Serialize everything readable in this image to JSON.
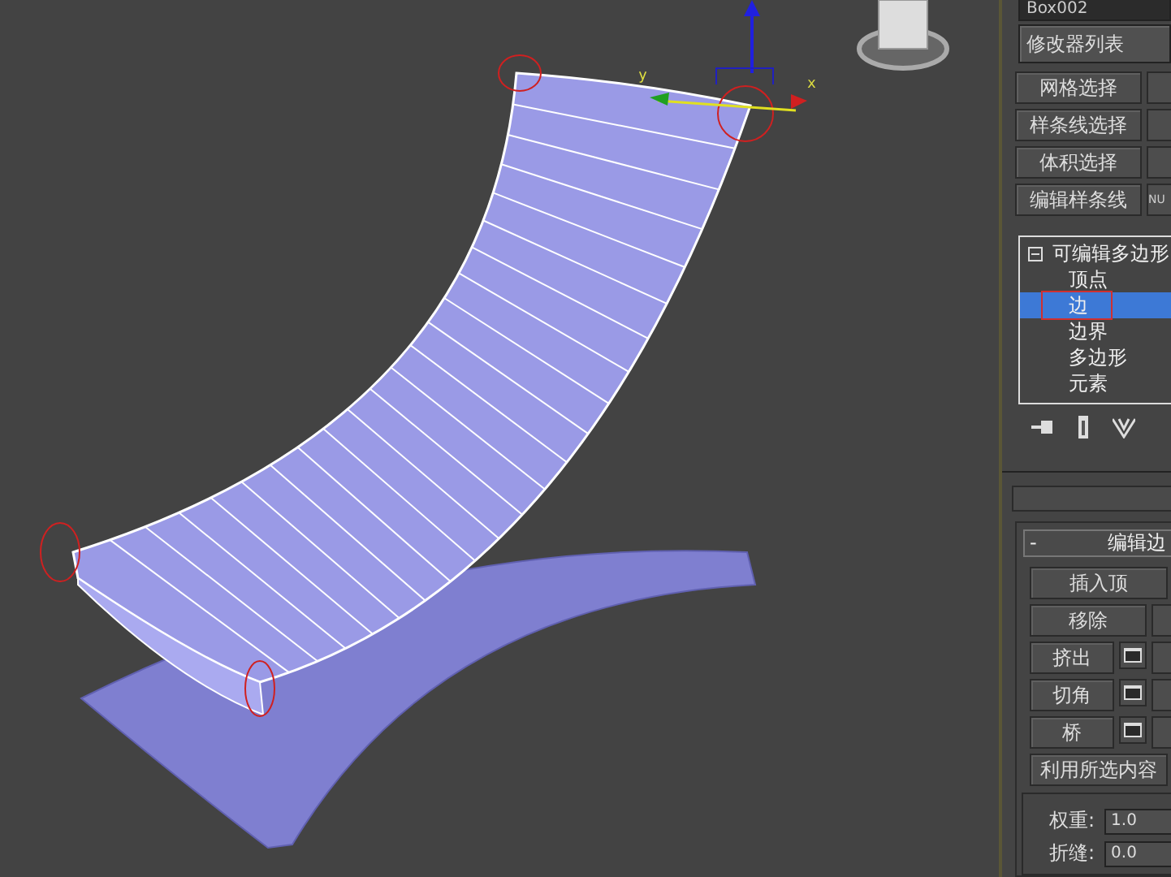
{
  "viewport": {
    "gizmo": {
      "x_label": "x",
      "y_label": "y"
    }
  },
  "panel": {
    "object_name": "Box002",
    "modifier_list": "修改器列表",
    "modifier_buttons": [
      {
        "label": "网格选择"
      },
      {
        "label": "样条线选择"
      },
      {
        "label": "体积选择"
      },
      {
        "label": "编辑样条线",
        "extra": "NU"
      }
    ],
    "stack": [
      {
        "label": "可编辑多边形",
        "expanded": true,
        "selected": false,
        "children": [
          {
            "label": "顶点",
            "selected": false
          },
          {
            "label": "边",
            "selected": true
          },
          {
            "label": "边界",
            "selected": false
          },
          {
            "label": "多边形",
            "selected": false
          },
          {
            "label": "元素",
            "selected": false
          }
        ]
      }
    ],
    "rollout": {
      "collapse_sign": "-",
      "title": "编辑边",
      "buttons": [
        {
          "kind": "wide",
          "label": "插入顶"
        },
        {
          "kind": "plain",
          "label": "移除"
        },
        {
          "kind": "settings",
          "label": "挤出"
        },
        {
          "kind": "settings",
          "label": "切角"
        },
        {
          "kind": "settings",
          "label": "桥"
        },
        {
          "kind": "wide",
          "label": "利用所选内容"
        }
      ],
      "fields": [
        {
          "label": "权重:",
          "value": "1.0"
        },
        {
          "label": "折缝:",
          "value": "0.0"
        }
      ]
    }
  }
}
